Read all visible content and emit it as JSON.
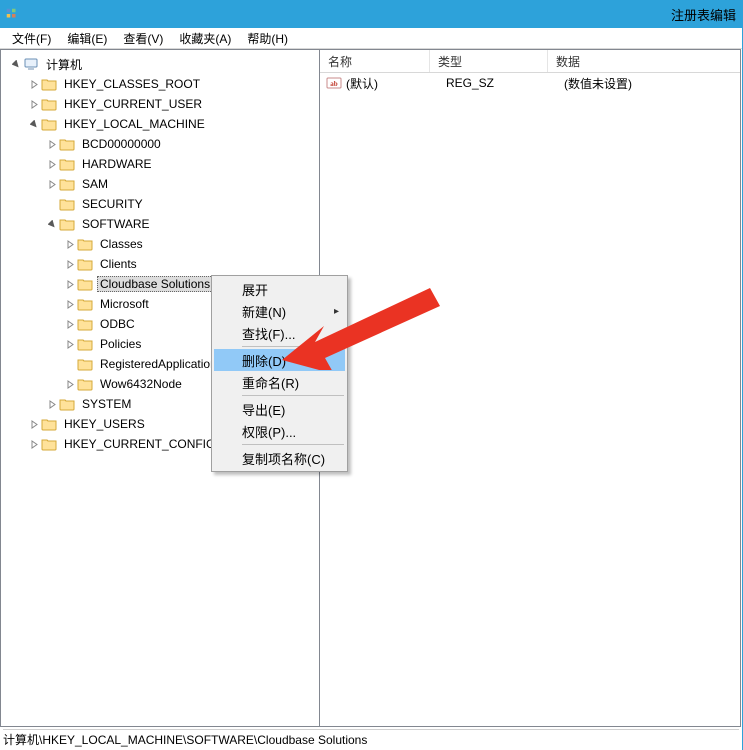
{
  "window": {
    "title": "注册表编辑"
  },
  "menu": {
    "file": "文件(F)",
    "edit": "编辑(E)",
    "view": "查看(V)",
    "favorites": "收藏夹(A)",
    "help": "帮助(H)"
  },
  "tree": {
    "root": "计算机",
    "hkcr": "HKEY_CLASSES_ROOT",
    "hkcu": "HKEY_CURRENT_USER",
    "hklm": "HKEY_LOCAL_MACHINE",
    "bcd": "BCD00000000",
    "hardware": "HARDWARE",
    "sam": "SAM",
    "security": "SECURITY",
    "software": "SOFTWARE",
    "classes": "Classes",
    "clients": "Clients",
    "cloudbase": "Cloudbase Solutions",
    "microsoft": "Microsoft",
    "odbc": "ODBC",
    "policies": "Policies",
    "regapps": "RegisteredApplications",
    "wow": "Wow6432Node",
    "system": "SYSTEM",
    "hku": "HKEY_USERS",
    "hkcc": "HKEY_CURRENT_CONFIG"
  },
  "columns": {
    "name": "名称",
    "type": "类型",
    "data": "数据"
  },
  "values": {
    "default": {
      "name": "(默认)",
      "type": "REG_SZ",
      "data": "(数值未设置)"
    }
  },
  "ctx": {
    "expand": "展开",
    "new": "新建(N)",
    "find": "查找(F)...",
    "delete": "删除(D)",
    "rename": "重命名(R)",
    "export": "导出(E)",
    "permissions": "权限(P)...",
    "copykey": "复制项名称(C)"
  },
  "status": "计算机\\HKEY_LOCAL_MACHINE\\SOFTWARE\\Cloudbase Solutions"
}
